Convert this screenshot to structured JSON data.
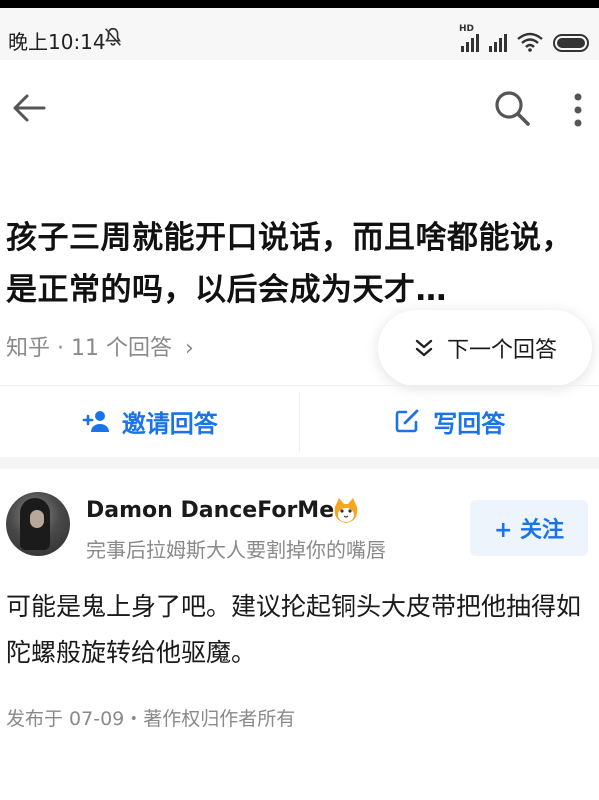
{
  "status_bar": {
    "time": "晚上10:14",
    "hd_label": "HD",
    "icons": [
      "bell-mute-icon",
      "signal-icon",
      "signal-icon",
      "wifi-icon",
      "battery-icon"
    ]
  },
  "top_bar": {
    "icons": [
      "back-arrow-icon",
      "search-icon",
      "more-vertical-icon"
    ]
  },
  "question": {
    "title": "孩子三周就能开口说话，而且啥都能说，是正常的吗，以后会成为天才…",
    "meta": "知乎 · 11 个回答",
    "meta_chevron": "›"
  },
  "next_answer": {
    "label": "下一个回答"
  },
  "actions": {
    "invite_label": "邀请回答",
    "write_label": "写回答"
  },
  "answer": {
    "author_name": "Damon DanceForMe",
    "author_bio": "完事后拉姆斯大人要割掉你的嘴唇",
    "follow_label": "+ 关注",
    "content": "可能是鬼上身了吧。建议抡起铜头大皮带把他抽得如陀螺般旋转给他驱魔。",
    "footer": "发布于 07-09・著作权归作者所有"
  },
  "colors": {
    "accent": "#1a73e8",
    "muted_text": "#8a8a8a",
    "follow_bg": "#eef4fc"
  }
}
